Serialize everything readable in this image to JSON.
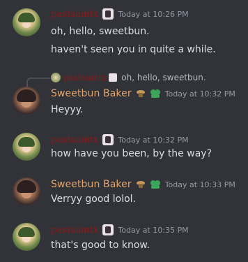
{
  "messages": [
    {
      "author": "pastsaintx",
      "time": "Today at 10:26 PM",
      "lines": [
        "oh, hello, sweetbun.",
        "haven't seen you in quite a while."
      ]
    },
    {
      "author": "Sweetbun Baker",
      "time": "Today at 10:32 PM",
      "reply_author": "pastsaintx",
      "reply_text": "oh, hello, sweetbun.",
      "lines": [
        "Heyyy."
      ]
    },
    {
      "author": "pastsaintx",
      "time": "Today at 10:32 PM",
      "lines": [
        "how have you been, by the way?"
      ]
    },
    {
      "author": "Sweetbun Baker",
      "time": "Today at 10:33 PM",
      "lines": [
        "Verryy good lolol."
      ]
    },
    {
      "author": "pastsaintx",
      "time": "Today at 10:35 PM",
      "lines": [
        "that's good to know."
      ]
    }
  ],
  "colors": {
    "pastel_name": "#8b1a1a",
    "sweet_name": "#e0a36a",
    "background": "#313338",
    "badge_green": "#3ba55c"
  }
}
